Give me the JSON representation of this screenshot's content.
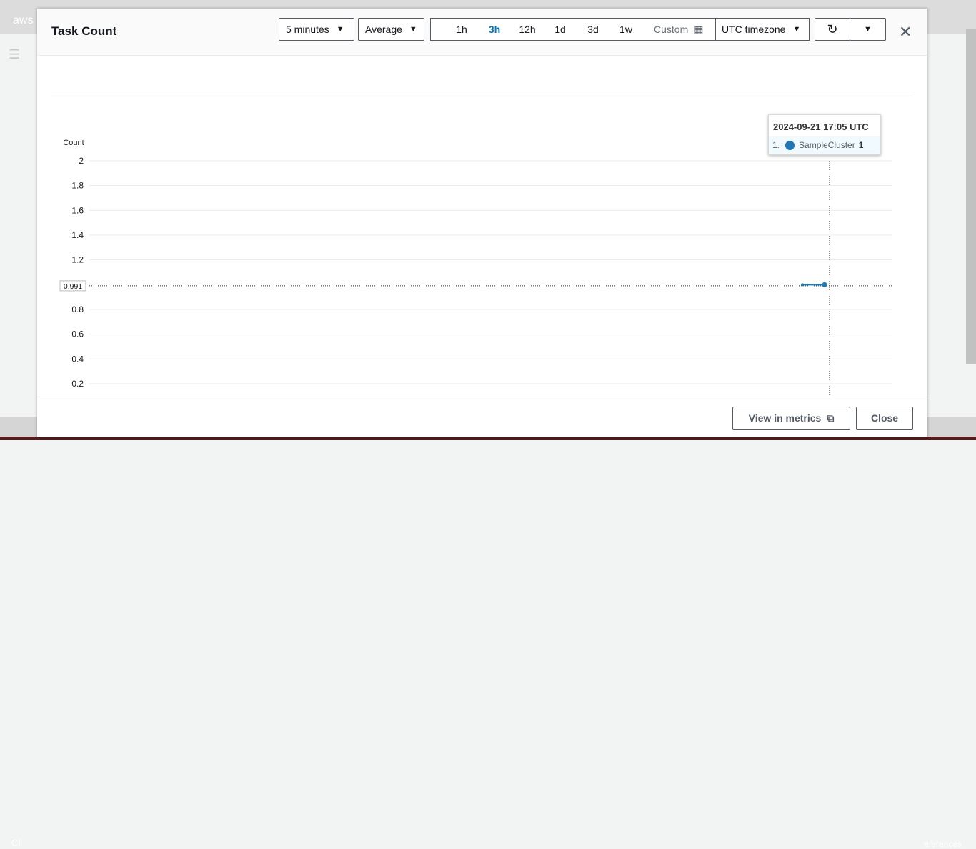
{
  "background": {
    "logo": "aws",
    "bottom_left": "Cl",
    "bottom_right": "eferences"
  },
  "modal": {
    "title": "Task Count",
    "period": "5 minutes",
    "statistic": "Average",
    "ranges": [
      {
        "label": "1h",
        "selected": false
      },
      {
        "label": "3h",
        "selected": true
      },
      {
        "label": "12h",
        "selected": false
      },
      {
        "label": "1d",
        "selected": false
      },
      {
        "label": "3d",
        "selected": false
      },
      {
        "label": "1w",
        "selected": false
      }
    ],
    "custom_label": "Custom",
    "timezone": "UTC timezone",
    "footer": {
      "view_in_metrics": "View in metrics",
      "close": "Close"
    }
  },
  "chart_data": {
    "type": "line",
    "ylabel": "Count",
    "yticks": [
      "2",
      "1.8",
      "1.6",
      "1.4",
      "1.2",
      "0.8",
      "0.6",
      "0.4",
      "0.2"
    ],
    "ylim": [
      0.2,
      2
    ],
    "grid": true,
    "crosshair_value": "0.991",
    "series": [
      {
        "name": "SampleCluster",
        "color": "#1f77b4",
        "values": [
          1,
          1
        ]
      }
    ],
    "tooltip": {
      "time": "2024-09-21 17:05 UTC",
      "index": "1.",
      "series": "SampleCluster",
      "value": "1"
    }
  }
}
